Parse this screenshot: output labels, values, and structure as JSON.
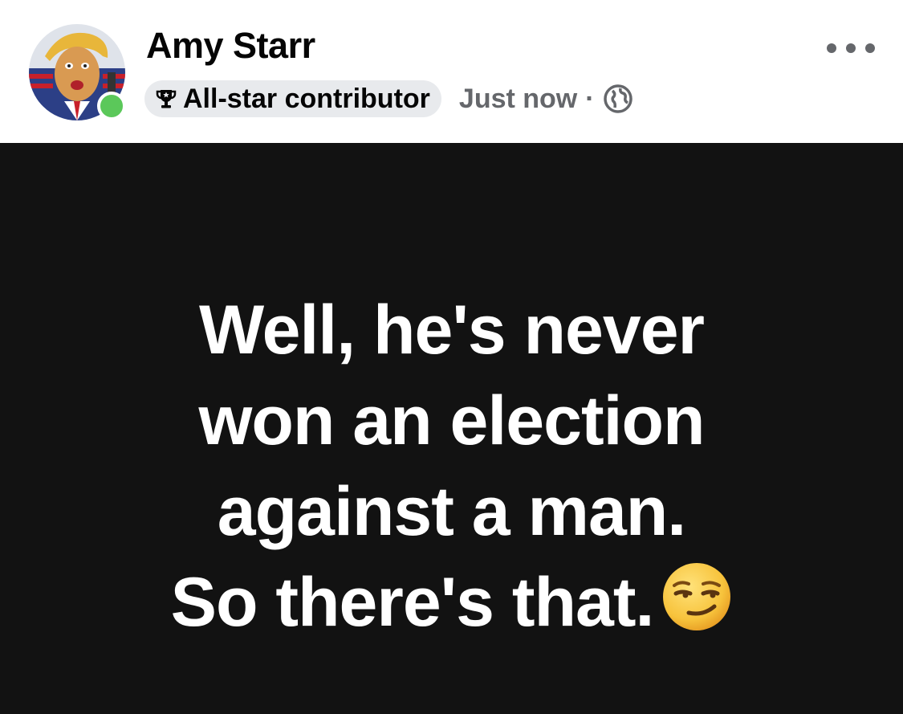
{
  "post": {
    "author": {
      "name": "Amy Starr",
      "avatar_icon": "avatar-caricature-icon",
      "online": true
    },
    "badge": {
      "icon": "trophy-icon",
      "label": "All-star contributor"
    },
    "timestamp": "Just now",
    "separator": "·",
    "audience_icon": "globe-icon",
    "more_icon": "more-options-icon",
    "text_lines": [
      "Well, he's never",
      "won an election",
      "against a man.",
      "So there's that."
    ],
    "emoji": "smirking-face-emoji",
    "colors": {
      "post_background": "#121212",
      "post_text": "#ffffff",
      "badge_background": "#e8eaed",
      "secondary_text": "#65676b",
      "online_dot": "#5bc85a"
    }
  }
}
